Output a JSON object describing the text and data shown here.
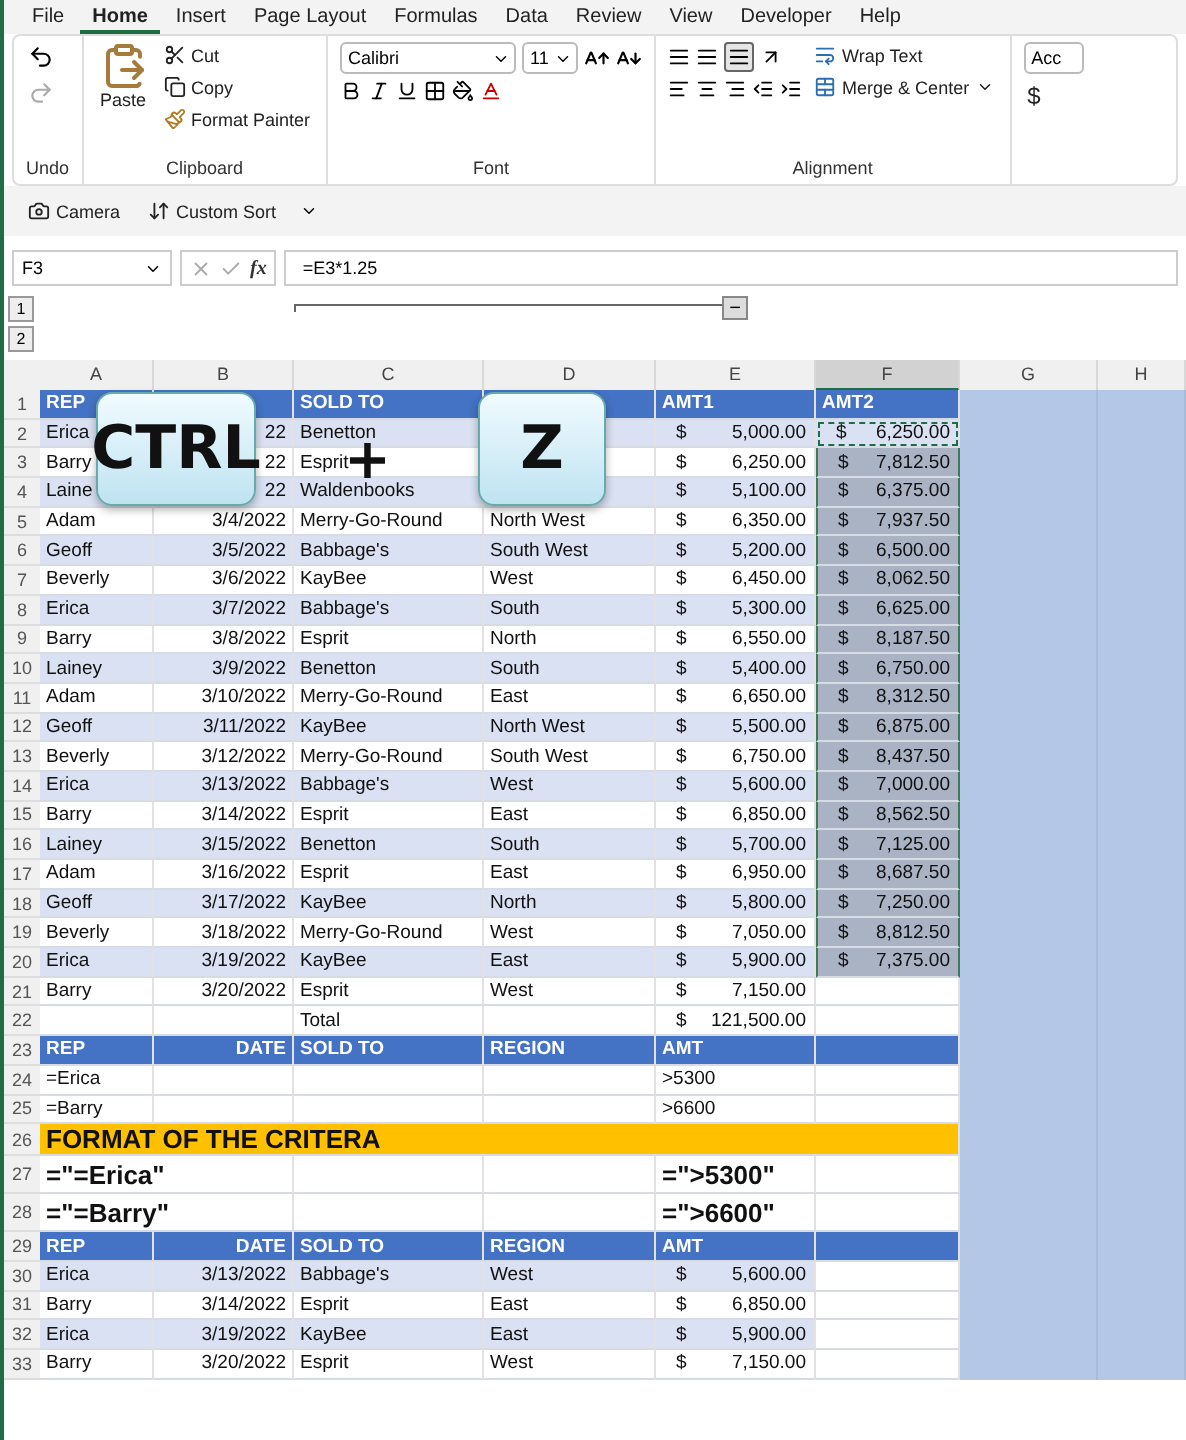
{
  "menu_tabs": [
    {
      "label": "File",
      "selected": false
    },
    {
      "label": "Home",
      "selected": true
    },
    {
      "label": "Insert",
      "selected": false
    },
    {
      "label": "Page Layout",
      "selected": false
    },
    {
      "label": "Formulas",
      "selected": false
    },
    {
      "label": "Data",
      "selected": false
    },
    {
      "label": "Review",
      "selected": false
    },
    {
      "label": "View",
      "selected": false
    },
    {
      "label": "Developer",
      "selected": false
    },
    {
      "label": "Help",
      "selected": false
    }
  ],
  "ribbon": {
    "undo_group": "Undo",
    "clipboard": {
      "paste": "Paste",
      "cut": "Cut",
      "copy": "Copy",
      "format_painter": "Format Painter",
      "label": "Clipboard"
    },
    "font": {
      "name": "Calibri",
      "size": "11",
      "label": "Font"
    },
    "alignment": {
      "wrap_text": "Wrap Text",
      "merge_center": "Merge & Center",
      "label": "Alignment"
    },
    "number_format": "Acc",
    "currency": "$"
  },
  "quick_access": [
    {
      "label": "Camera",
      "kind": "camera"
    },
    {
      "label": "Custom Sort",
      "kind": "sort"
    }
  ],
  "formula_bar": {
    "name_box": "F3",
    "fx": "fx",
    "formula": "=E3*1.25"
  },
  "outline": {
    "levels": [
      "1",
      "2"
    ],
    "collapse": "−"
  },
  "columns": [
    {
      "label": "A",
      "selected": false
    },
    {
      "label": "B",
      "selected": false
    },
    {
      "label": "C",
      "selected": false
    },
    {
      "label": "D",
      "selected": false
    },
    {
      "label": "E",
      "selected": false
    },
    {
      "label": "F",
      "selected": true
    },
    {
      "label": "G",
      "selected": false
    },
    {
      "label": "H",
      "selected": false
    }
  ],
  "rows": [
    {
      "num": "1",
      "kind": "header",
      "cells": [
        "REP",
        null,
        "SOLD TO",
        null,
        "AMT1",
        "AMT2"
      ]
    },
    {
      "num": "2",
      "kind": "data",
      "banded": true,
      "f_selected": false,
      "f_copied": true,
      "cells": [
        "Erica",
        "22",
        "Benetton",
        null,
        {
          "symbol": "$",
          "amount": "5,000.00"
        },
        {
          "symbol": "$",
          "amount": "6,250.00"
        }
      ]
    },
    {
      "num": "3",
      "kind": "data",
      "banded": false,
      "f_selected": true,
      "f_copied": false,
      "cells": [
        "Barry",
        "22",
        "Esprit",
        null,
        {
          "symbol": "$",
          "amount": "6,250.00"
        },
        {
          "symbol": "$",
          "amount": "7,812.50"
        }
      ]
    },
    {
      "num": "4",
      "kind": "data",
      "banded": true,
      "f_selected": true,
      "f_copied": false,
      "cells": [
        "Laine",
        "22",
        "Waldenbooks",
        null,
        {
          "symbol": "$",
          "amount": "5,100.00"
        },
        {
          "symbol": "$",
          "amount": "6,375.00"
        }
      ]
    },
    {
      "num": "5",
      "kind": "data",
      "banded": false,
      "f_selected": true,
      "f_copied": false,
      "cells": [
        "Adam",
        "3/4/2022",
        "Merry-Go-Round",
        "North West",
        {
          "symbol": "$",
          "amount": "6,350.00"
        },
        {
          "symbol": "$",
          "amount": "7,937.50"
        }
      ]
    },
    {
      "num": "6",
      "kind": "data",
      "banded": true,
      "f_selected": true,
      "f_copied": false,
      "cells": [
        "Geoff",
        "3/5/2022",
        "Babbage's",
        "South West",
        {
          "symbol": "$",
          "amount": "5,200.00"
        },
        {
          "symbol": "$",
          "amount": "6,500.00"
        }
      ]
    },
    {
      "num": "7",
      "kind": "data",
      "banded": false,
      "f_selected": true,
      "f_copied": false,
      "cells": [
        "Beverly",
        "3/6/2022",
        "KayBee",
        "West",
        {
          "symbol": "$",
          "amount": "6,450.00"
        },
        {
          "symbol": "$",
          "amount": "8,062.50"
        }
      ]
    },
    {
      "num": "8",
      "kind": "data",
      "banded": true,
      "f_selected": true,
      "f_copied": false,
      "cells": [
        "Erica",
        "3/7/2022",
        "Babbage's",
        "South",
        {
          "symbol": "$",
          "amount": "5,300.00"
        },
        {
          "symbol": "$",
          "amount": "6,625.00"
        }
      ]
    },
    {
      "num": "9",
      "kind": "data",
      "banded": false,
      "f_selected": true,
      "f_copied": false,
      "cells": [
        "Barry",
        "3/8/2022",
        "Esprit",
        "North",
        {
          "symbol": "$",
          "amount": "6,550.00"
        },
        {
          "symbol": "$",
          "amount": "8,187.50"
        }
      ]
    },
    {
      "num": "10",
      "kind": "data",
      "banded": true,
      "f_selected": true,
      "f_copied": false,
      "cells": [
        "Lainey",
        "3/9/2022",
        "Benetton",
        "South",
        {
          "symbol": "$",
          "amount": "5,400.00"
        },
        {
          "symbol": "$",
          "amount": "6,750.00"
        }
      ]
    },
    {
      "num": "11",
      "kind": "data",
      "banded": false,
      "f_selected": true,
      "f_copied": false,
      "cells": [
        "Adam",
        "3/10/2022",
        "Merry-Go-Round",
        "East",
        {
          "symbol": "$",
          "amount": "6,650.00"
        },
        {
          "symbol": "$",
          "amount": "8,312.50"
        }
      ]
    },
    {
      "num": "12",
      "kind": "data",
      "banded": true,
      "f_selected": true,
      "f_copied": false,
      "cells": [
        "Geoff",
        "3/11/2022",
        "KayBee",
        "North West",
        {
          "symbol": "$",
          "amount": "5,500.00"
        },
        {
          "symbol": "$",
          "amount": "6,875.00"
        }
      ]
    },
    {
      "num": "13",
      "kind": "data",
      "banded": false,
      "f_selected": true,
      "f_copied": false,
      "cells": [
        "Beverly",
        "3/12/2022",
        "Merry-Go-Round",
        "South West",
        {
          "symbol": "$",
          "amount": "6,750.00"
        },
        {
          "symbol": "$",
          "amount": "8,437.50"
        }
      ]
    },
    {
      "num": "14",
      "kind": "data",
      "banded": true,
      "f_selected": true,
      "f_copied": false,
      "cells": [
        "Erica",
        "3/13/2022",
        "Babbage's",
        "West",
        {
          "symbol": "$",
          "amount": "5,600.00"
        },
        {
          "symbol": "$",
          "amount": "7,000.00"
        }
      ]
    },
    {
      "num": "15",
      "kind": "data",
      "banded": false,
      "f_selected": true,
      "f_copied": false,
      "cells": [
        "Barry",
        "3/14/2022",
        "Esprit",
        "East",
        {
          "symbol": "$",
          "amount": "6,850.00"
        },
        {
          "symbol": "$",
          "amount": "8,562.50"
        }
      ]
    },
    {
      "num": "16",
      "kind": "data",
      "banded": true,
      "f_selected": true,
      "f_copied": false,
      "cells": [
        "Lainey",
        "3/15/2022",
        "Benetton",
        "South",
        {
          "symbol": "$",
          "amount": "5,700.00"
        },
        {
          "symbol": "$",
          "amount": "7,125.00"
        }
      ]
    },
    {
      "num": "17",
      "kind": "data",
      "banded": false,
      "f_selected": true,
      "f_copied": false,
      "cells": [
        "Adam",
        "3/16/2022",
        "Esprit",
        "East",
        {
          "symbol": "$",
          "amount": "6,950.00"
        },
        {
          "symbol": "$",
          "amount": "8,687.50"
        }
      ]
    },
    {
      "num": "18",
      "kind": "data",
      "banded": true,
      "f_selected": true,
      "f_copied": false,
      "cells": [
        "Geoff",
        "3/17/2022",
        "KayBee",
        "North",
        {
          "symbol": "$",
          "amount": "5,800.00"
        },
        {
          "symbol": "$",
          "amount": "7,250.00"
        }
      ]
    },
    {
      "num": "19",
      "kind": "data",
      "banded": false,
      "f_selected": true,
      "f_copied": false,
      "cells": [
        "Beverly",
        "3/18/2022",
        "Merry-Go-Round",
        "West",
        {
          "symbol": "$",
          "amount": "7,050.00"
        },
        {
          "symbol": "$",
          "amount": "8,812.50"
        }
      ]
    },
    {
      "num": "20",
      "kind": "data",
      "banded": true,
      "f_selected": true,
      "f_copied": false,
      "cells": [
        "Erica",
        "3/19/2022",
        "KayBee",
        "East",
        {
          "symbol": "$",
          "amount": "5,900.00"
        },
        {
          "symbol": "$",
          "amount": "7,375.00"
        }
      ]
    },
    {
      "num": "21",
      "kind": "data",
      "banded": false,
      "cells": [
        "Barry",
        "3/20/2022",
        "Esprit",
        "West",
        {
          "symbol": "$",
          "amount": "7,150.00"
        },
        null
      ]
    },
    {
      "num": "22",
      "kind": "data",
      "banded": false,
      "cells": [
        null,
        null,
        "Total",
        null,
        {
          "symbol": "$",
          "amount": "121,500.00"
        },
        null
      ]
    },
    {
      "num": "23",
      "kind": "header",
      "cells": [
        "REP",
        "DATE",
        "SOLD TO",
        "REGION",
        "AMT",
        null
      ]
    },
    {
      "num": "24",
      "kind": "data",
      "banded": false,
      "cells": [
        "=Erica",
        null,
        null,
        null,
        ">5300",
        null
      ]
    },
    {
      "num": "25",
      "kind": "data",
      "banded": false,
      "cells": [
        "=Barry",
        null,
        null,
        null,
        ">6600",
        null
      ]
    },
    {
      "num": "26",
      "kind": "banner",
      "cells": [
        "FORMAT OF THE CRITERA"
      ]
    },
    {
      "num": "27",
      "kind": "large",
      "cells": [
        "=\"=Erica\"",
        null,
        null,
        null,
        "=\">5300\"",
        null
      ]
    },
    {
      "num": "28",
      "kind": "large",
      "cells": [
        "=\"=Barry\"",
        null,
        null,
        null,
        "=\">6600\"",
        null
      ]
    },
    {
      "num": "29",
      "kind": "header",
      "cells": [
        "REP",
        "DATE",
        "SOLD TO",
        "REGION",
        "AMT",
        null
      ]
    },
    {
      "num": "30",
      "kind": "data",
      "banded": true,
      "cells": [
        "Erica",
        "3/13/2022",
        "Babbage's",
        "West",
        {
          "symbol": "$",
          "amount": "5,600.00"
        },
        null
      ]
    },
    {
      "num": "31",
      "kind": "data",
      "banded": false,
      "cells": [
        "Barry",
        "3/14/2022",
        "Esprit",
        "East",
        {
          "symbol": "$",
          "amount": "6,850.00"
        },
        null
      ]
    },
    {
      "num": "32",
      "kind": "data",
      "banded": true,
      "cells": [
        "Erica",
        "3/19/2022",
        "KayBee",
        "East",
        {
          "symbol": "$",
          "amount": "5,900.00"
        },
        null
      ]
    },
    {
      "num": "33",
      "kind": "data",
      "banded": false,
      "cells": [
        "Barry",
        "3/20/2022",
        "Esprit",
        "West",
        {
          "symbol": "$",
          "amount": "7,150.00"
        },
        null
      ]
    }
  ],
  "shortcut_overlay": {
    "keys": [
      "CTRL",
      "Z"
    ],
    "joiner": "+"
  }
}
